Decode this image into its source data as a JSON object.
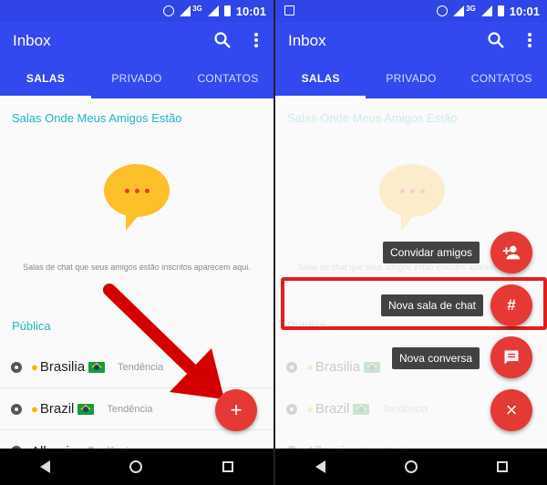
{
  "status_bar": {
    "time": "10:01",
    "network": "3G"
  },
  "app_bar": {
    "title": "Inbox"
  },
  "tabs": [
    {
      "label": "SALAS"
    },
    {
      "label": "PRIVADO"
    },
    {
      "label": "CONTATOS"
    }
  ],
  "friends_section": {
    "title": "Salas Onde Meus Amigos Estão",
    "empty_message": "Salas de chat que seus amigos estão inscritos aparecem aqui."
  },
  "public_section": {
    "title": "Pública",
    "rooms": [
      {
        "name": "Brasilia",
        "tag": "Tendência"
      },
      {
        "name": "Brazil",
        "tag": "Tendência"
      },
      {
        "name": "Albanian",
        "tag": "Tendência"
      }
    ]
  },
  "fab": {
    "add_glyph": "+",
    "close_glyph": "×",
    "hash_glyph": "#"
  },
  "speed_dial": [
    {
      "label": "Convidar amigos",
      "icon": "add-person-icon"
    },
    {
      "label": "Nova sala de chat",
      "icon": "hash-icon"
    },
    {
      "label": "Nova conversa",
      "icon": "message-icon"
    }
  ],
  "colors": {
    "primary": "#3349f0",
    "status_bar": "#2f45e8",
    "accent": "#e53935",
    "section_title": "#23b3c8",
    "highlight": "#e21e1e"
  }
}
